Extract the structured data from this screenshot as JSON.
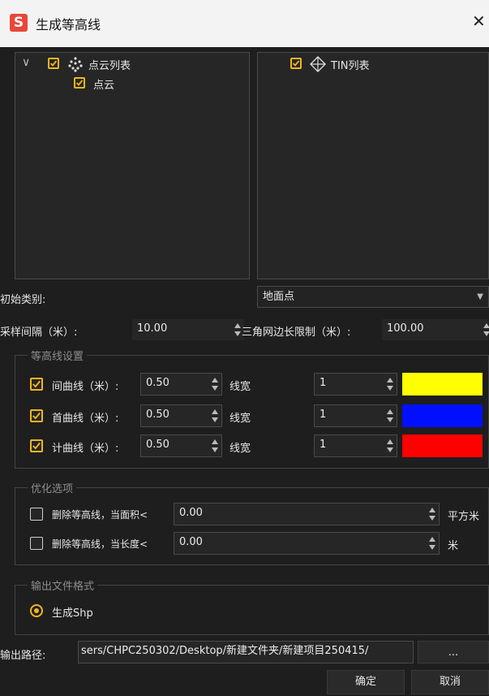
{
  "window": {
    "title": "生成等高线",
    "close_glyph": "✕"
  },
  "point_cloud_tree": {
    "expand_glyph": "∨",
    "root_label": "点云列表",
    "child_label": "点云"
  },
  "tin_tree": {
    "root_label": "TIN列表"
  },
  "initial_class": {
    "label": "初始类别:",
    "value": "地面点"
  },
  "sampling": {
    "label": "采样间隔（米）:",
    "value": "10.00"
  },
  "tin_edge": {
    "label": "三角网边长限制（米）:",
    "value": "100.00"
  },
  "contour_settings": {
    "title": "等高线设置",
    "rows": [
      {
        "label": "间曲线（米）:",
        "interval": "0.50",
        "width_label": "线宽",
        "width": "1",
        "color": "#ffff00"
      },
      {
        "label": "首曲线（米）:",
        "interval": "0.50",
        "width_label": "线宽",
        "width": "1",
        "color": "#0010ff"
      },
      {
        "label": "计曲线（米）:",
        "interval": "0.50",
        "width_label": "线宽",
        "width": "1",
        "color": "#ff0000"
      }
    ]
  },
  "optimize": {
    "title": "优化选项",
    "area": {
      "label": "删除等高线，当面积<",
      "value": "0.00",
      "unit": "平方米"
    },
    "length": {
      "label": "删除等高线，当长度<",
      "value": "0.00",
      "unit": "米"
    }
  },
  "output_format": {
    "title": "输出文件格式",
    "option": "生成Shp"
  },
  "output_path": {
    "label": "输出路径:",
    "value": "sers/CHPC250302/Desktop/新建文件夹/新建项目250415/",
    "browse": "..."
  },
  "buttons": {
    "ok": "确定",
    "cancel": "取消"
  },
  "colors": {
    "accent": "#f0b51e",
    "background": "#1e1e1e",
    "titlebar": "#f3f3f3"
  }
}
